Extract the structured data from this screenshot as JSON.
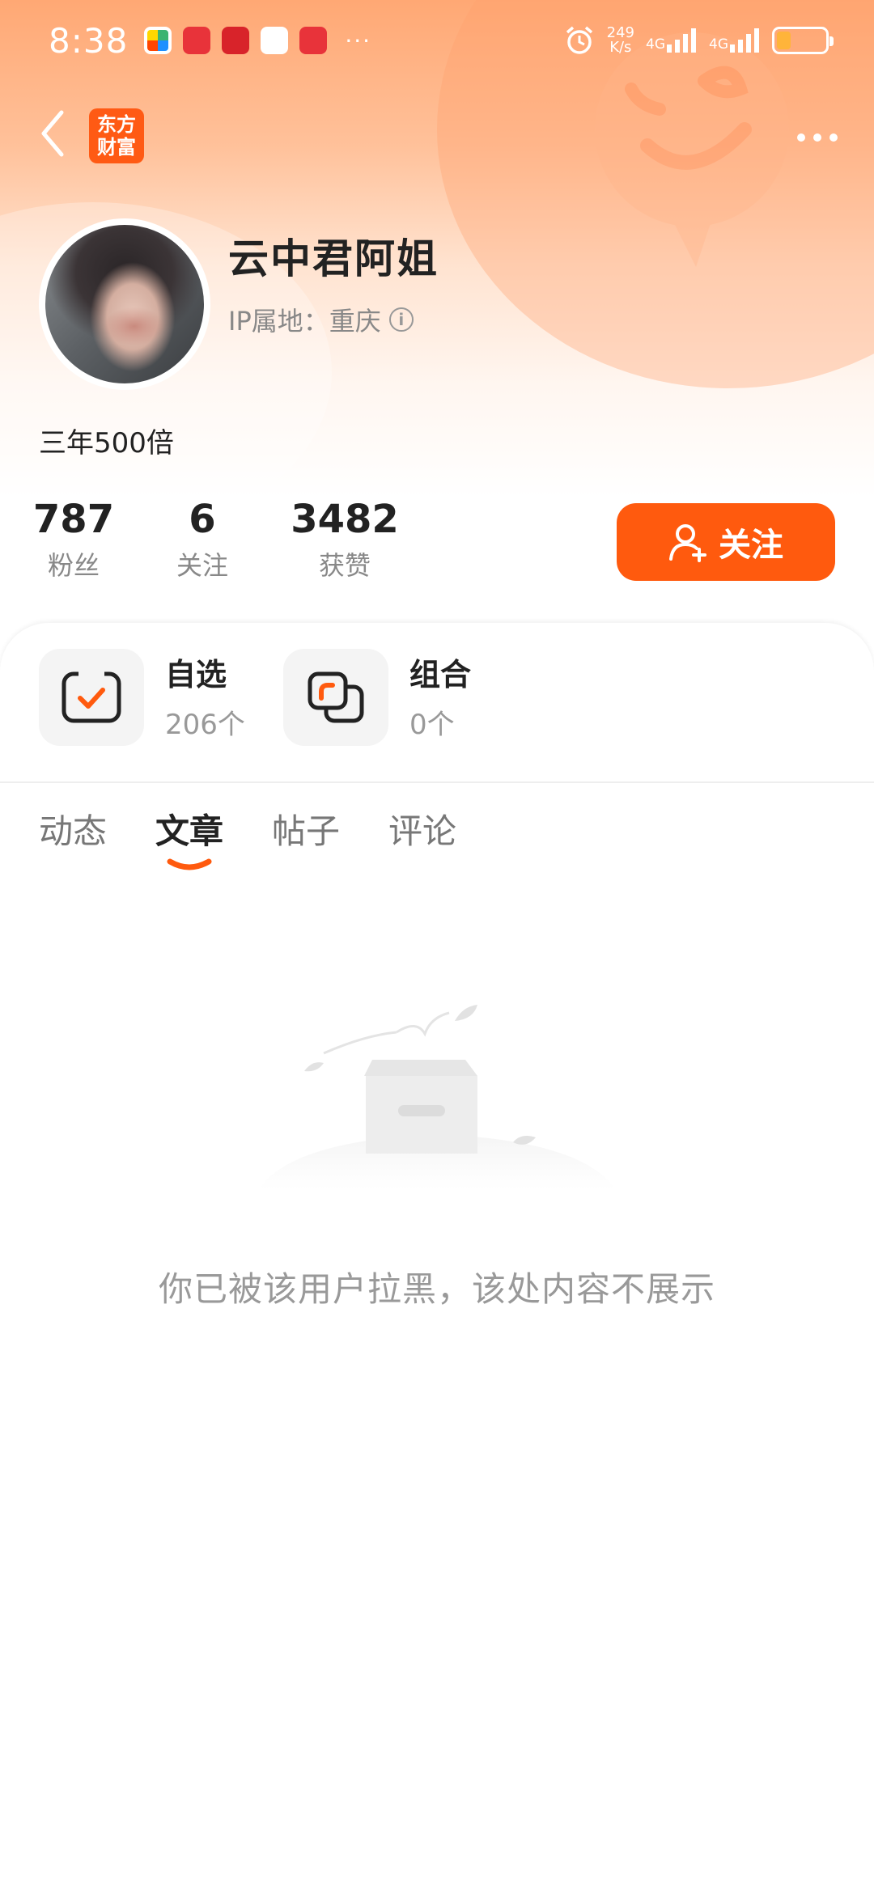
{
  "status_bar": {
    "time": "8:38",
    "speed_value": "249",
    "speed_unit": "K/s",
    "network_1": "4G",
    "network_2": "4G",
    "battery_level": 0.3
  },
  "nav": {
    "logo_line1": "东方",
    "logo_line2": "财富"
  },
  "profile": {
    "username": "云中君阿姐",
    "ip_location": "IP属地：重庆",
    "bio": "三年500倍"
  },
  "stats": [
    {
      "value": "787",
      "label": "粉丝"
    },
    {
      "value": "6",
      "label": "关注"
    },
    {
      "value": "3482",
      "label": "获赞"
    }
  ],
  "follow_button": {
    "label": "关注"
  },
  "assets": [
    {
      "title": "自选",
      "count": "206个"
    },
    {
      "title": "组合",
      "count": "0个"
    }
  ],
  "tabs": [
    {
      "label": "动态",
      "active": false
    },
    {
      "label": "文章",
      "active": true
    },
    {
      "label": "帖子",
      "active": false
    },
    {
      "label": "评论",
      "active": false
    }
  ],
  "empty_state": {
    "message": "你已被该用户拉黑，该处内容不展示"
  },
  "colors": {
    "accent": "#ff5a0e",
    "header_gradient_top": "#ffa874",
    "muted_text": "#999999"
  }
}
